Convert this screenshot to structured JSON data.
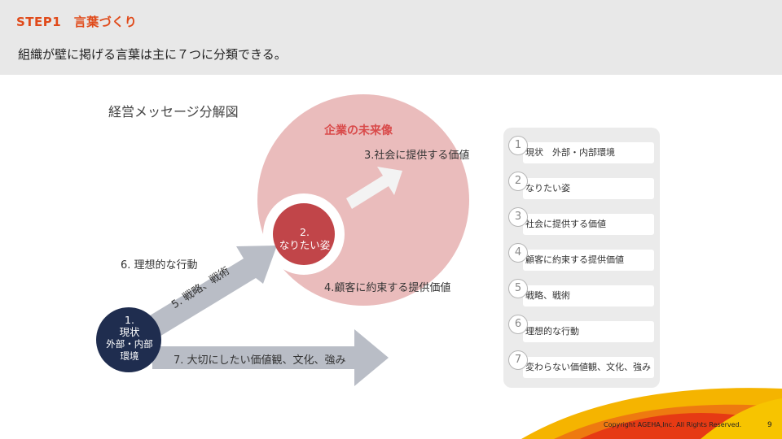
{
  "header": {
    "step_title": "STEP1　言葉づくり",
    "subtitle": "組織が壁に掲げる言葉は主に７つに分類できる。"
  },
  "diagram": {
    "title": "経営メッセージ分解図",
    "vision_title": "企業の未来像",
    "label_3": "3.社会に提供する価値",
    "label_4": "4.顧客に約束する提供価値",
    "label_5": "5. 戦略、戦術",
    "label_6": "6. 理想的な行動",
    "label_7": "7. 大切にしたい価値観、文化、強み",
    "circle_2": {
      "line1": "2.",
      "line2": "なりたい姿"
    },
    "circle_1": {
      "line1": "1.",
      "line2": "現状",
      "line3": "外部・内部",
      "line4": "環境"
    },
    "colors": {
      "vision_circle": "#eabcbc",
      "accent_red": "#c14549",
      "navy": "#1f2d4f",
      "arrow_gray": "#b9bdc6",
      "white_arrow": "#f3f3f3"
    }
  },
  "side_list": {
    "items": [
      {
        "num": "1",
        "label": "現状　外部・内部環境"
      },
      {
        "num": "2",
        "label": "なりたい姿"
      },
      {
        "num": "3",
        "label": "社会に提供する価値"
      },
      {
        "num": "4",
        "label": "顧客に約束する提供価値"
      },
      {
        "num": "5",
        "label": "戦略、戦術"
      },
      {
        "num": "6",
        "label": "理想的な行動"
      },
      {
        "num": "7",
        "label": "変わらない価値観、文化、強み"
      }
    ]
  },
  "footer": {
    "copyright": "Copyright AGEHA,Inc. All Rights Reserved.",
    "page": "9"
  }
}
